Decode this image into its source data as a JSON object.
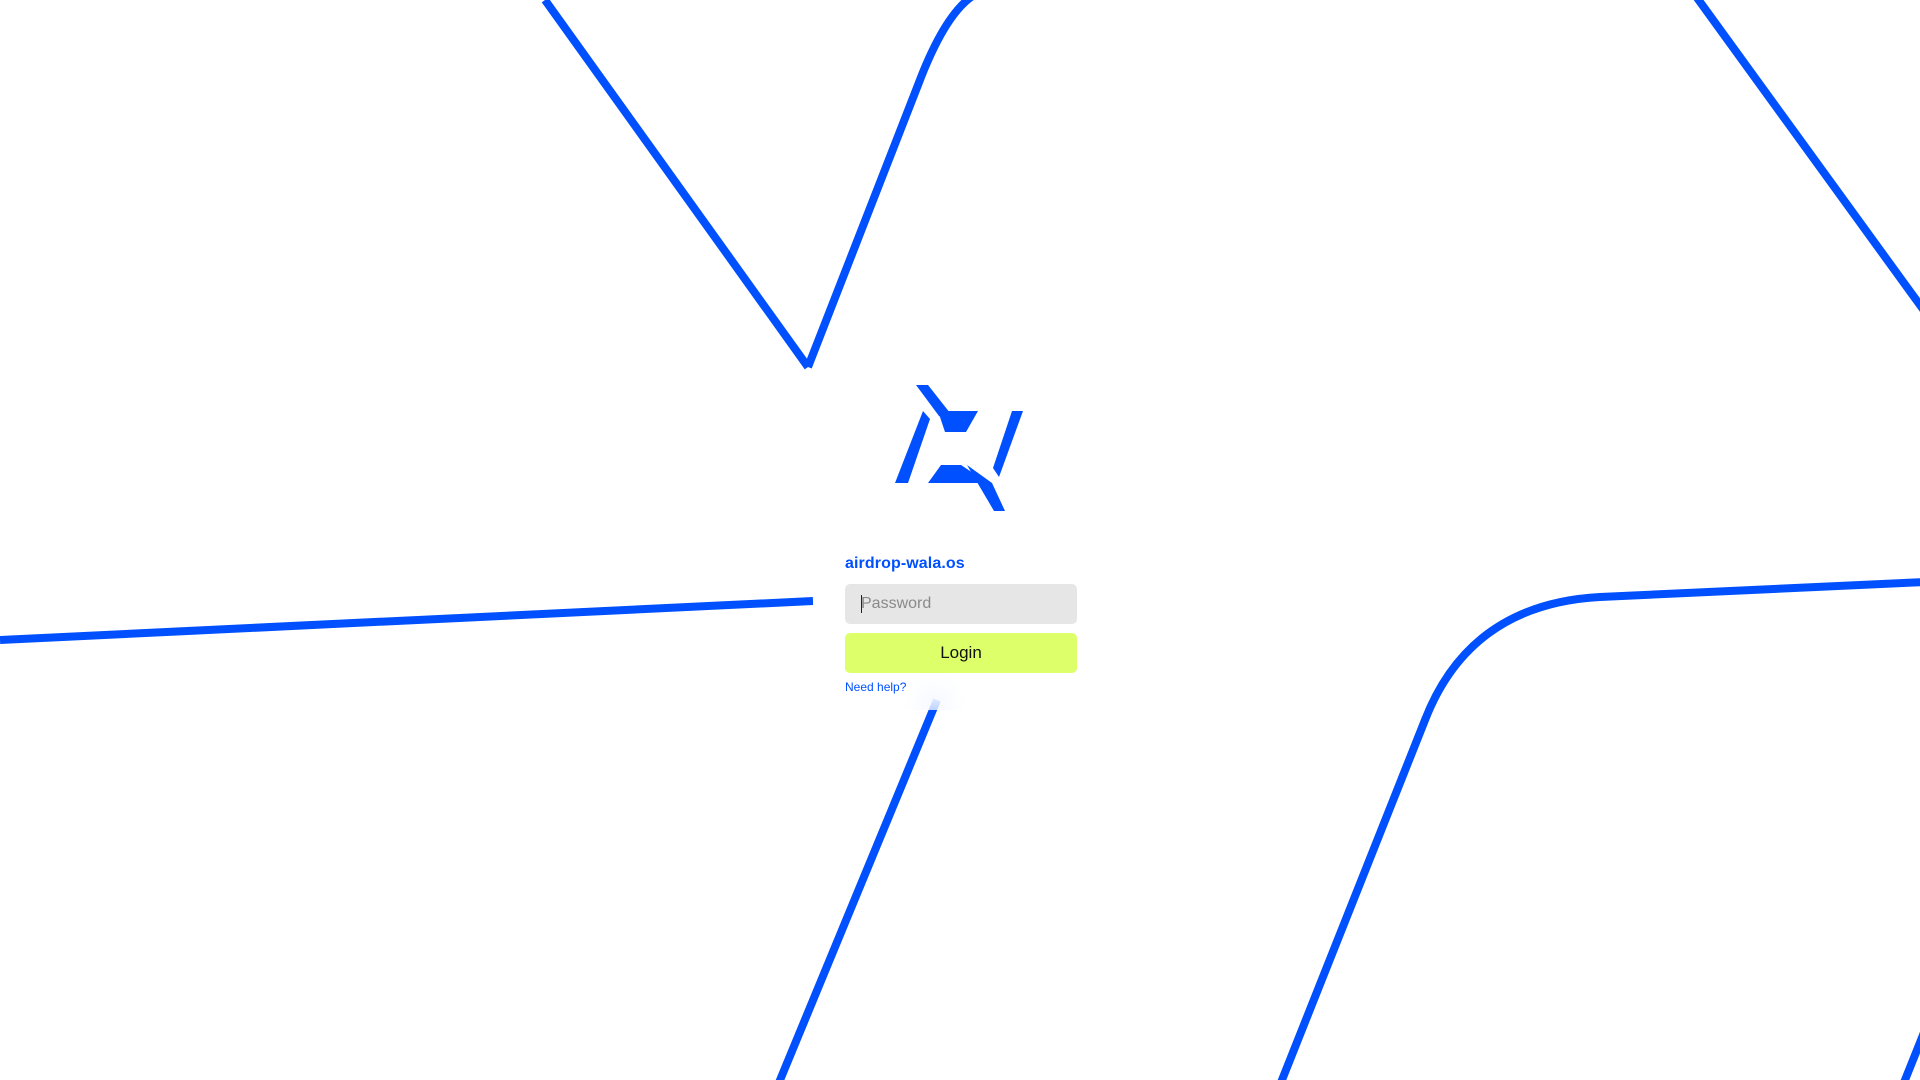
{
  "background": {
    "line_color": "#0050ff",
    "pattern": "large-stylized-logo-outline"
  },
  "logo": {
    "name": "airdrop-wala-logo-icon",
    "color": "#0050ff"
  },
  "login": {
    "username": "airdrop-wala.os",
    "password_placeholder": "Password",
    "password_value": "",
    "button_label": "Login",
    "help_link": "Need help?",
    "button_color": "#dcff6a",
    "field_color": "#e6e6e6"
  }
}
